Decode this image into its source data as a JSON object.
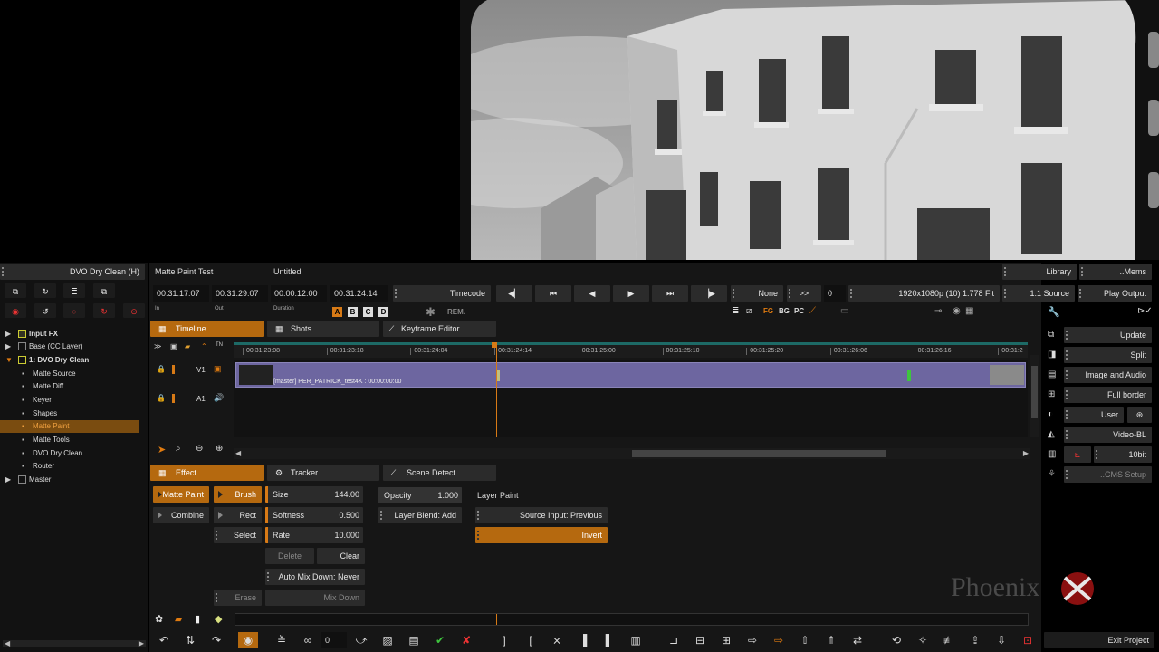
{
  "node_panel": {
    "title": "DVO Dry Clean (H)",
    "tree": [
      {
        "label": "Input FX",
        "level": 0,
        "expanded": false,
        "highlight": "yellow"
      },
      {
        "label": "Base (CC Layer)",
        "level": 0,
        "expanded": false
      },
      {
        "label": "1: DVO Dry Clean",
        "level": 0,
        "expanded": true,
        "highlight": "yellow"
      },
      {
        "label": "Matte Source",
        "level": 1
      },
      {
        "label": "Matte Diff",
        "level": 1
      },
      {
        "label": "Keyer",
        "level": 1
      },
      {
        "label": "Shapes",
        "level": 1
      },
      {
        "label": "Matte Paint",
        "level": 1,
        "selected": true
      },
      {
        "label": "Matte Tools",
        "level": 1
      },
      {
        "label": "DVO Dry Clean",
        "level": 1
      },
      {
        "label": "Router",
        "level": 1
      },
      {
        "label": "Master",
        "level": 0,
        "expanded": false
      }
    ]
  },
  "header": {
    "project": "Matte Paint Test",
    "sequence": "Untitled",
    "in_tc": "00:31:17:07",
    "out_tc": "00:31:29:07",
    "duration_tc": "00:00:12:00",
    "current_tc": "00:31:24:14",
    "in_label": "In",
    "out_label": "Out",
    "duration_label": "Duration",
    "timecode_label": "Timecode",
    "none_label": "None",
    "ff_label": ">>",
    "ff_value": "0",
    "format": "1920x1080p (10) 1.778 Fit",
    "source": "1:1 Source",
    "play_output": "Play Output",
    "library": "Library",
    "mems": "..Mems",
    "abcd": [
      "A",
      "B",
      "C",
      "D"
    ],
    "rem": "REM.",
    "fg": "FG",
    "bg": "BG",
    "pc": "PC"
  },
  "tabs": {
    "timeline": "Timeline",
    "shots": "Shots",
    "keyframe_editor": "Keyframe Editor",
    "effect": "Effect",
    "tracker": "Tracker",
    "scene_detect": "Scene Detect"
  },
  "timeline": {
    "ticks": [
      "00:31:23:08",
      "00:31:23:18",
      "00:31:24:04",
      "00:31:24:14",
      "00:31:25:00",
      "00:31:25:10",
      "00:31:25:20",
      "00:31:26:06",
      "00:31:26:16",
      "00:31:2"
    ],
    "tracks": {
      "video": "V1",
      "audio": "A1"
    },
    "clip_label": "[master] PER_PATRICK_test4K : 00:00:00:00",
    "playhead_fraction": 0.331
  },
  "effect": {
    "matte_paint": "Matte Paint",
    "combine": "Combine",
    "brush": "Brush",
    "rect": "Rect",
    "select": "Select",
    "erase": "Erase",
    "size_label": "Size",
    "size_value": "144.00",
    "softness_label": "Softness",
    "softness_value": "0.500",
    "rate_label": "Rate",
    "rate_value": "10.000",
    "delete": "Delete",
    "clear": "Clear",
    "auto_mix": "Auto Mix Down: Never",
    "mix_down": "Mix Down",
    "opacity_label": "Opacity",
    "opacity_value": "1.000",
    "layer_blend": "Layer Blend: Add",
    "layer_paint": "Layer Paint",
    "source_input": "Source Input: Previous",
    "invert": "Invert"
  },
  "right_panel": {
    "update": "Update",
    "split": "Split",
    "image_audio": "Image and Audio",
    "full_border": "Full border",
    "user": "User",
    "video_bl": "Video-BL",
    "bit": "10bit",
    "cms_setup": "..CMS Setup"
  },
  "brand": "Phoenix",
  "bottom": {
    "frame_value": "0",
    "exit": "Exit Project"
  },
  "colors": {
    "accent_orange": "#d77a16",
    "clip_purple": "#6d66a0",
    "panel_bg": "#161616",
    "button_bg": "#2b2b2b"
  }
}
